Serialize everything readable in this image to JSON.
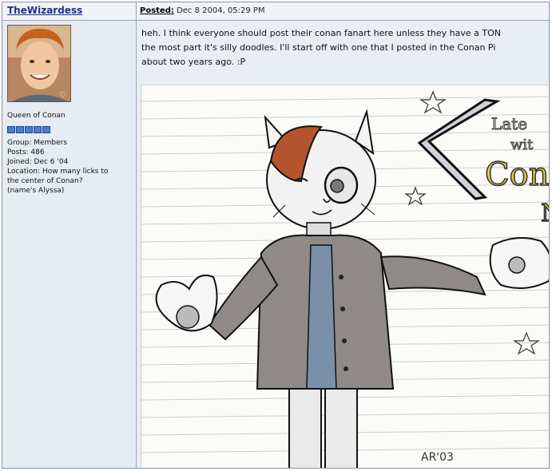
{
  "post": {
    "username": "TheWizardess",
    "posted_label": "Posted:",
    "posted_date": "Dec 8 2004, 05:29 PM",
    "text_lines": [
      "heh. I think everyone should post their conan fanart here unless they have a TON",
      "the most part it's silly doodles. I'll start off with one that I posted in the Conan Pi",
      "about two years ago. :P"
    ]
  },
  "profile": {
    "rank_title": "Queen of Conan",
    "rank_pips": 5,
    "group": "Group: Members",
    "posts": "Posts: 486",
    "joined": "Joined: Dec 6 '04",
    "location_line1": "Location: How many licks to",
    "location_line2": "the center of Conan?",
    "location_line3": "(name's Alyssa)"
  },
  "image": {
    "headline_word1": "Late",
    "headline_word2": "wit",
    "headline_word3": "Con",
    "signature": "AR'03"
  },
  "colors": {
    "header_bg": "#f1f3f6",
    "profile_bg": "#e6ecf4",
    "username": "#1c2f8f",
    "pip": "#4a7bd0"
  }
}
